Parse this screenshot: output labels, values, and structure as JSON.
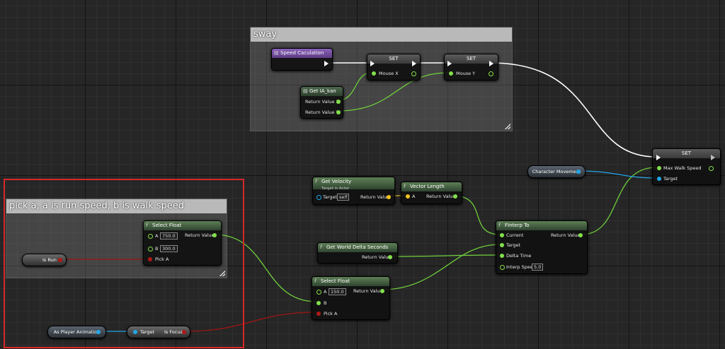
{
  "comments": {
    "sway": "sway",
    "pick": "pick a, a is run speed, b is walk speed"
  },
  "speed_calc": {
    "title": "Speed Caculation"
  },
  "set_mouse_x": {
    "title": "SET",
    "pin": "Mouse X"
  },
  "set_mouse_y": {
    "title": "SET",
    "pin": "Mouse Y"
  },
  "get_ia": {
    "title": "Get IA_kan",
    "out_x": "Return Value X",
    "out_y": "Return Value Y"
  },
  "set_walk": {
    "title": "SET",
    "pin_speed": "Max Walk Speed",
    "pin_target": "Target"
  },
  "char_movement": {
    "label": "Character Movement"
  },
  "get_velocity": {
    "title": "Get Velocity",
    "subtitle": "Target is Actor",
    "target_label": "Target",
    "target_value": "self",
    "return": "Return Value"
  },
  "vector_length": {
    "title": "Vector Length",
    "in_a": "A",
    "return": "Return Value"
  },
  "world_delta": {
    "title": "Get World Delta Seconds",
    "return": "Return Value"
  },
  "finterp": {
    "title": "FInterp To",
    "current": "Current",
    "target": "Target",
    "delta": "Delta Time",
    "interp_label": "Interp Speed",
    "interp_value": "5.0",
    "return": "Return Value"
  },
  "select_float_top": {
    "title": "Select Float",
    "a_label": "A",
    "a_value": "750.0",
    "b_label": "B",
    "b_value": "300.0",
    "pick": "Pick A",
    "return": "Return Value"
  },
  "select_float_bottom": {
    "title": "Select Float",
    "a_label": "A",
    "a_value": "150.0",
    "b_label": "B",
    "pick": "Pick A",
    "return": "Return Value"
  },
  "is_run": {
    "label": "Is Run"
  },
  "as_player_anim": {
    "label": "As Player Animation"
  },
  "is_focus": {
    "target": "Target",
    "label": "Is Focus"
  },
  "colors": {
    "exec": "#ffffff",
    "float": "#82e04a",
    "bool": "#b01818",
    "object": "#22a6e8",
    "vector": "#f2c320",
    "selection": "#d62828"
  }
}
